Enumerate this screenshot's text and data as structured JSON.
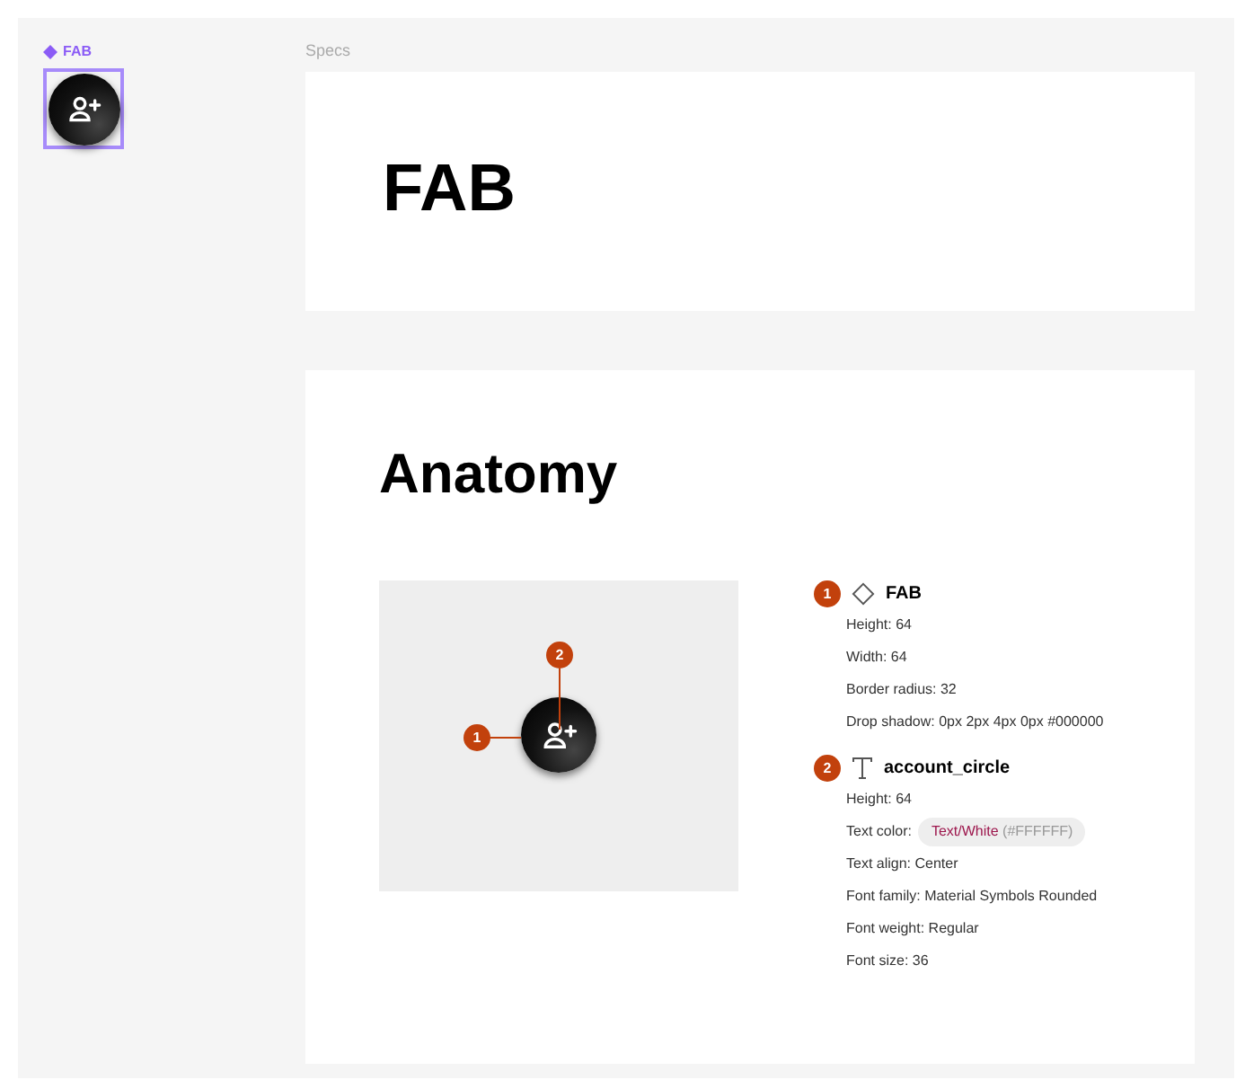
{
  "component_label": "FAB",
  "specs_label": "Specs",
  "title_card": {
    "title": "FAB"
  },
  "anatomy": {
    "title": "Anatomy",
    "diagram_markers": [
      {
        "number": "1",
        "kind": "left"
      },
      {
        "number": "2",
        "kind": "top"
      }
    ],
    "sections": [
      {
        "number": "1",
        "kind": "component",
        "name": "FAB",
        "properties": [
          {
            "kind": "text",
            "text": "Height: 64"
          },
          {
            "kind": "text",
            "text": "Width: 64"
          },
          {
            "kind": "text",
            "text": "Border radius: 32"
          },
          {
            "kind": "text",
            "text": "Drop shadow: 0px 2px 4px 0px #000000"
          }
        ]
      },
      {
        "number": "2",
        "kind": "text",
        "name": "account_circle",
        "properties": [
          {
            "kind": "text",
            "text": "Height: 64"
          },
          {
            "kind": "token",
            "text": "Text color:",
            "token": "Text/White",
            "hex": "(#FFFFFF)"
          },
          {
            "kind": "text",
            "text": "Text align: Center"
          },
          {
            "kind": "text",
            "text": "Font family: Material Symbols Rounded"
          },
          {
            "kind": "text",
            "text": "Font weight: Regular"
          },
          {
            "kind": "text",
            "text": "Font size: 36"
          }
        ]
      }
    ]
  }
}
